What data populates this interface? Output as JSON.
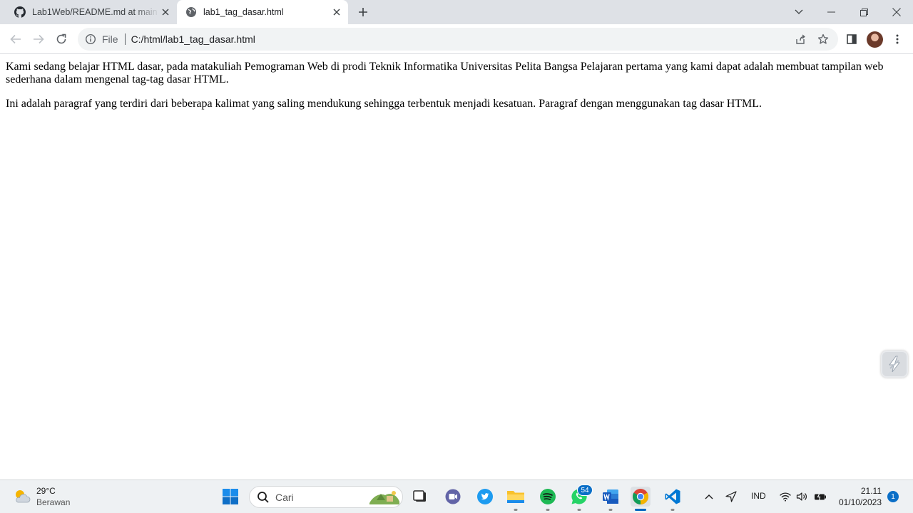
{
  "browser": {
    "tabs": [
      {
        "title": "Lab1Web/README.md at main · ",
        "favicon": "github-icon",
        "active": false
      },
      {
        "title": "lab1_tag_dasar.html",
        "favicon": "globe-icon",
        "active": true
      }
    ],
    "toolbar": {
      "scheme_label": "File",
      "url": "C:/html/lab1_tag_dasar.html"
    }
  },
  "page": {
    "paragraphs": [
      "Kami sedang belajar HTML dasar, pada matakuliah Pemograman Web di prodi Teknik Informatika Universitas Pelita Bangsa Pelajaran pertama yang kami dapat adalah membuat tampilan web sederhana dalam mengenal tag-tag dasar HTML.",
      "Ini adalah paragraf yang terdiri dari beberapa kalimat yang saling mendukung sehingga terbentuk menjadi kesatuan. Paragraf dengan menggunakan tag dasar HTML."
    ]
  },
  "taskbar": {
    "weather": {
      "temp": "29°C",
      "desc": "Berawan"
    },
    "search_placeholder": "Cari",
    "whatsapp_badge": "54",
    "language": "IND",
    "time": "21.11",
    "date": "01/10/2023",
    "notification_count": "1"
  },
  "colors": {
    "tabstrip_bg": "#dee1e6",
    "accent": "#0067c0"
  }
}
